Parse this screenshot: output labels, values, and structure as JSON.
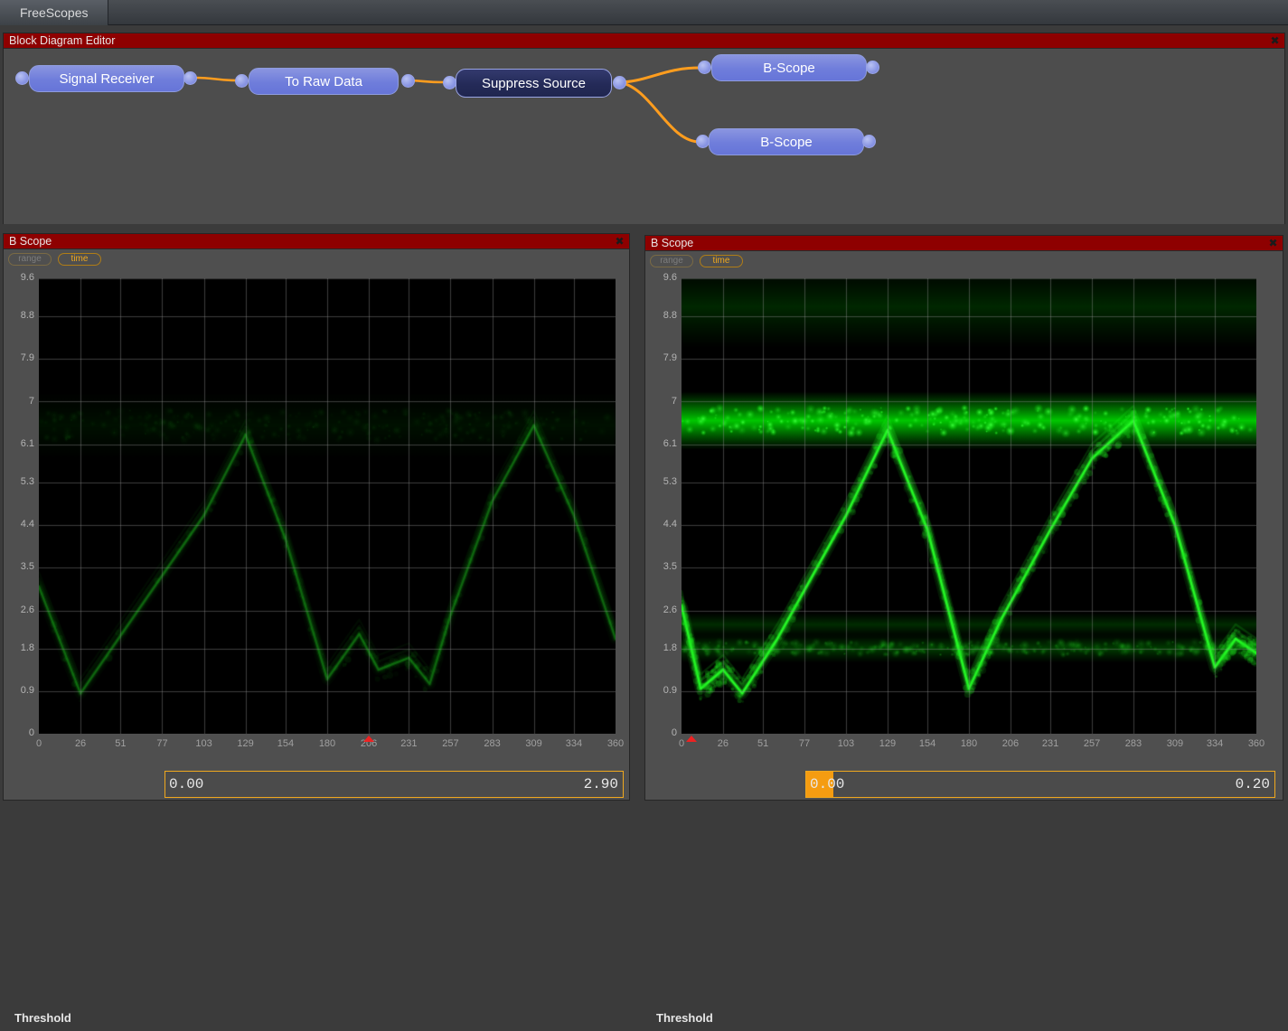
{
  "app": {
    "tab_label": "FreeScopes",
    "colors": {
      "title_bar": "#8e0000",
      "accent_orange": "#f0a81e",
      "node_fill": "#6f7ddb",
      "node_fill_selected": "#242a58",
      "wire": "#ff9d1e",
      "trace_green": "#00d000",
      "marker_red": "#ee2222"
    }
  },
  "block_diagram": {
    "title": "Block Diagram Editor",
    "close_icon": "✖",
    "nodes": [
      {
        "label": "Signal Receiver",
        "state": "normal"
      },
      {
        "label": "To Raw Data",
        "state": "normal"
      },
      {
        "label": "Suppress Source",
        "state": "selected"
      },
      {
        "label": "B-Scope",
        "state": "normal"
      },
      {
        "label": "B-Scope",
        "state": "normal"
      }
    ]
  },
  "scopes": [
    {
      "title": "B Scope",
      "close_icon": "✖",
      "buttons": [
        {
          "label": "range",
          "active": false
        },
        {
          "label": "time",
          "active": true
        }
      ],
      "threshold": {
        "label": "Threshold",
        "min": "0.00",
        "max": "2.90",
        "fill_fraction": 0.0
      },
      "chart_data": {
        "type": "heatmap",
        "title": "B Scope",
        "xlabel": "time",
        "ylabel": "range",
        "xticks": [
          0,
          26,
          51,
          77,
          103,
          129,
          154,
          180,
          206,
          231,
          257,
          283,
          309,
          334,
          360
        ],
        "yticks": [
          0,
          0.9,
          1.8,
          2.6,
          3.5,
          4.4,
          5.3,
          6.1,
          7,
          7.9,
          8.8,
          9.6
        ],
        "xlim": [
          0,
          360
        ],
        "ylim": [
          0,
          9.6
        ],
        "grid": true,
        "legend": "none",
        "colormap": "black-to-green",
        "intensity_scale": 0.28,
        "marker_x": 206,
        "bands": [
          {
            "center_y": 6.5,
            "thickness": 0.33,
            "intensity": 0.3,
            "kind": "clutter-line"
          }
        ],
        "traces": [
          {
            "name": "range-doppler-track",
            "kind": "triangle-wave",
            "points": [
              {
                "x": 0,
                "y": 3.1
              },
              {
                "x": 26,
                "y": 0.85
              },
              {
                "x": 103,
                "y": 4.6
              },
              {
                "x": 129,
                "y": 6.3
              },
              {
                "x": 154,
                "y": 4.1
              },
              {
                "x": 180,
                "y": 1.15
              },
              {
                "x": 200,
                "y": 2.1
              },
              {
                "x": 212,
                "y": 1.35
              },
              {
                "x": 231,
                "y": 1.6
              },
              {
                "x": 244,
                "y": 1.05
              },
              {
                "x": 257,
                "y": 2.5
              },
              {
                "x": 283,
                "y": 4.9
              },
              {
                "x": 309,
                "y": 6.5
              },
              {
                "x": 334,
                "y": 4.6
              },
              {
                "x": 360,
                "y": 2.0
              }
            ]
          }
        ]
      }
    },
    {
      "title": "B Scope",
      "close_icon": "✖",
      "buttons": [
        {
          "label": "range",
          "active": false
        },
        {
          "label": "time",
          "active": true
        }
      ],
      "threshold": {
        "label": "Threshold",
        "min": "0.00",
        "max": "0.20",
        "fill_fraction": 0.057
      },
      "chart_data": {
        "type": "heatmap",
        "title": "B Scope",
        "xlabel": "time",
        "ylabel": "range",
        "xticks": [
          0,
          26,
          51,
          77,
          103,
          129,
          154,
          180,
          206,
          231,
          257,
          283,
          309,
          334,
          360
        ],
        "yticks": [
          0,
          0.9,
          1.8,
          2.6,
          3.5,
          4.4,
          5.3,
          6.1,
          7,
          7.9,
          8.8,
          9.6
        ],
        "xlim": [
          0,
          360
        ],
        "ylim": [
          0,
          9.6
        ],
        "grid": true,
        "legend": "none",
        "colormap": "black-to-green",
        "intensity_scale": 1.0,
        "marker_x": 6,
        "bands": [
          {
            "center_y": 6.6,
            "thickness": 0.28,
            "intensity": 1.0,
            "kind": "clutter-line"
          },
          {
            "center_y": 1.8,
            "thickness": 0.14,
            "intensity": 0.3,
            "kind": "clutter-line"
          },
          {
            "center_y": 2.3,
            "thickness": 0.12,
            "intensity": 0.22,
            "kind": "clutter-line"
          },
          {
            "center_y": 9.0,
            "thickness": 0.4,
            "intensity": 0.2,
            "kind": "clutter-line"
          }
        ],
        "traces": [
          {
            "name": "range-doppler-track",
            "kind": "triangle-wave",
            "points": [
              {
                "x": 0,
                "y": 2.7
              },
              {
                "x": 12,
                "y": 0.95
              },
              {
                "x": 26,
                "y": 1.35
              },
              {
                "x": 38,
                "y": 0.85
              },
              {
                "x": 60,
                "y": 2.0
              },
              {
                "x": 103,
                "y": 4.6
              },
              {
                "x": 129,
                "y": 6.4
              },
              {
                "x": 154,
                "y": 4.3
              },
              {
                "x": 180,
                "y": 0.95
              },
              {
                "x": 200,
                "y": 2.4
              },
              {
                "x": 231,
                "y": 4.3
              },
              {
                "x": 257,
                "y": 5.8
              },
              {
                "x": 283,
                "y": 6.6
              },
              {
                "x": 309,
                "y": 4.4
              },
              {
                "x": 334,
                "y": 1.4
              },
              {
                "x": 347,
                "y": 2.0
              },
              {
                "x": 360,
                "y": 1.7
              }
            ]
          }
        ]
      }
    }
  ]
}
